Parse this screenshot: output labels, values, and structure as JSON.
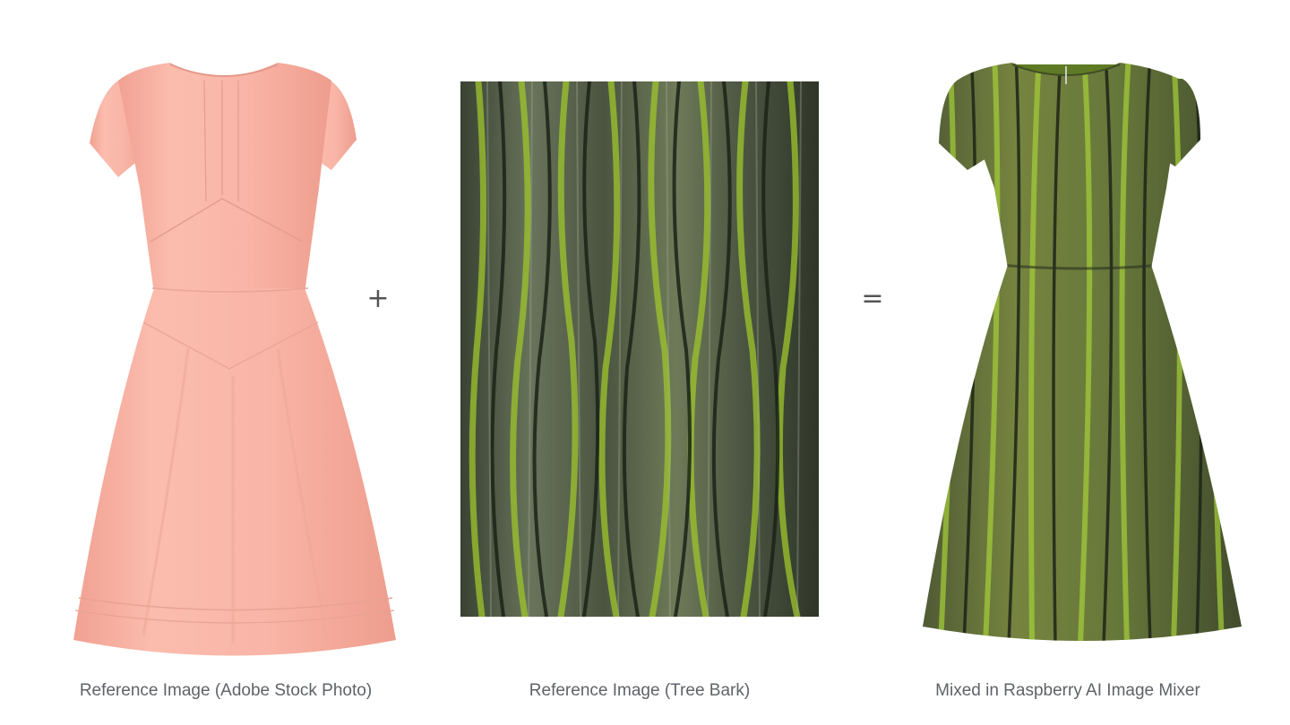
{
  "mixer": {
    "left": {
      "caption": "Reference Image (Adobe Stock Photo)",
      "image": "pink-dress-image",
      "dress_color": "#f8b2a4"
    },
    "plus_operator": "+",
    "middle": {
      "caption": "Reference Image (Tree Bark)",
      "image": "tree-bark-image",
      "bark_colors": [
        "#3e4437",
        "#6f7a57",
        "#9aa35f",
        "#9dcc2a"
      ]
    },
    "equals_operator": "=",
    "right": {
      "caption": "Mixed in Raspberry AI Image Mixer",
      "image": "bark-textured-dress-image",
      "dress_color": "#66773a"
    }
  }
}
